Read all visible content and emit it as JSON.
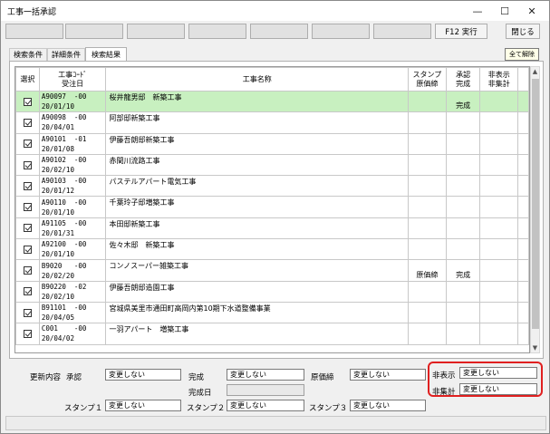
{
  "window": {
    "title": "工事一括承認",
    "minimize": "—",
    "maximize": "☐",
    "close": "✕"
  },
  "toolbar": {
    "f12_label": "F12 実行",
    "close_label": "閉じる",
    "all_clear_label": "全て解除"
  },
  "tabs": [
    {
      "label": "検索条件"
    },
    {
      "label": "詳細条件"
    },
    {
      "label": "検索結果"
    }
  ],
  "grid": {
    "headers": {
      "select": "選択",
      "code1": "工事ｺｰﾄﾞ",
      "code2": "受注日",
      "name": "工事名称",
      "stamp1": "スタンプ",
      "stamp2": "原価締",
      "approve1": "承認",
      "approve2": "完成",
      "hide1": "非表示",
      "hide2": "非集計"
    },
    "rows": [
      {
        "code": "A90097",
        "suffix": "-00",
        "date": "20/01/10",
        "name": "桜井龍男邸　新築工事",
        "stamp": "",
        "approve": "完成",
        "selected": true
      },
      {
        "code": "A90098",
        "suffix": "-00",
        "date": "20/04/01",
        "name": "阿部邸新築工事",
        "stamp": "",
        "approve": "",
        "selected": false
      },
      {
        "code": "A90101",
        "suffix": "-01",
        "date": "20/01/08",
        "name": "伊藤吾朗邸新築工事",
        "stamp": "",
        "approve": "",
        "selected": false
      },
      {
        "code": "A90102",
        "suffix": "-00",
        "date": "20/02/10",
        "name": "赤間川流路工事",
        "stamp": "",
        "approve": "",
        "selected": false
      },
      {
        "code": "A90103",
        "suffix": "-00",
        "date": "20/01/12",
        "name": "パステルアパート電気工事",
        "stamp": "",
        "approve": "",
        "selected": false
      },
      {
        "code": "A90110",
        "suffix": "-00",
        "date": "20/01/10",
        "name": "千葉玲子邸増築工事",
        "stamp": "",
        "approve": "",
        "selected": false
      },
      {
        "code": "A91105",
        "suffix": "-00",
        "date": "20/01/31",
        "name": "本田邸新築工事",
        "stamp": "",
        "approve": "",
        "selected": false
      },
      {
        "code": "A92100",
        "suffix": "-00",
        "date": "20/01/10",
        "name": "佐々木邸　新築工事",
        "stamp": "",
        "approve": "",
        "selected": false
      },
      {
        "code": "B9020",
        "suffix": "-00",
        "date": "20/02/20",
        "name": "コンノスーパー雑築工事",
        "stamp": "原価締",
        "approve": "完成",
        "selected": false
      },
      {
        "code": "B90220",
        "suffix": "-02",
        "date": "20/02/10",
        "name": "伊藤吾朗邸造園工事",
        "stamp": "",
        "approve": "",
        "selected": false
      },
      {
        "code": "B91101",
        "suffix": "-00",
        "date": "20/04/05",
        "name": "宮城県美里市通田町高岡内第10期下水道整備事業",
        "stamp": "",
        "approve": "",
        "selected": false
      },
      {
        "code": "C001",
        "suffix": "-00",
        "date": "20/04/02",
        "name": "一羽アパート　増築工事",
        "stamp": "",
        "approve": "",
        "selected": false
      }
    ]
  },
  "form": {
    "update_label": "更新内容",
    "approve_label": "承認",
    "approve_value": "変更しない",
    "complete_label": "完成",
    "complete_value": "変更しない",
    "cost_label": "原価締",
    "cost_value": "変更しない",
    "complete_date_label": "完成日",
    "complete_date_value": "",
    "stamp1_label": "スタンプ１",
    "stamp1_value": "変更しない",
    "stamp2_label": "スタンプ２",
    "stamp2_value": "変更しない",
    "stamp3_label": "スタンプ３",
    "stamp3_value": "変更しない",
    "hide_label": "非表示",
    "hide_value": "変更しない",
    "nocount_label": "非集計",
    "nocount_value": "変更しない"
  },
  "colors": {
    "selected_row": "#c8f0c0",
    "highlight_box": "#e02020"
  }
}
